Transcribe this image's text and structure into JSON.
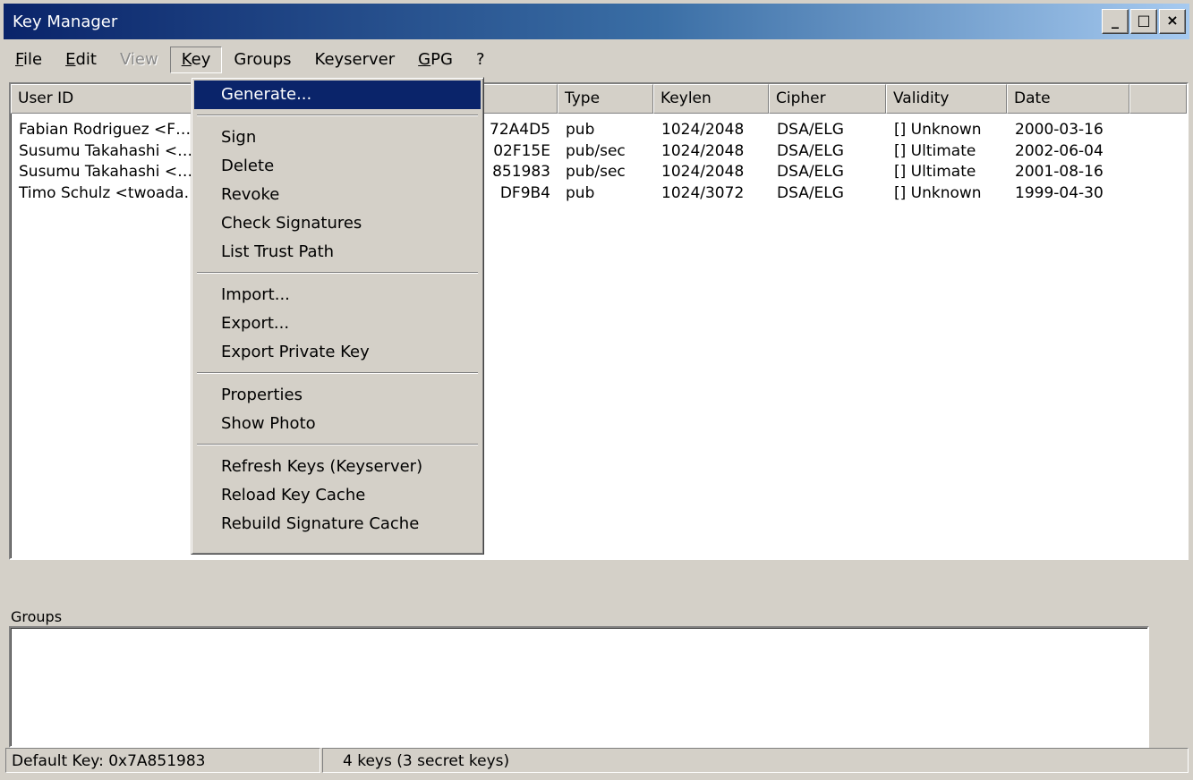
{
  "window": {
    "title": "Key Manager"
  },
  "titlebar_buttons": {
    "minimize": "_",
    "maximize": "□",
    "close": "×"
  },
  "menubar": [
    {
      "label": "File",
      "underline": "F",
      "rest": "ile",
      "state": "normal"
    },
    {
      "label": "Edit",
      "underline": "E",
      "rest": "dit",
      "state": "normal"
    },
    {
      "label": "View",
      "underline": "",
      "rest": "View",
      "state": "disabled"
    },
    {
      "label": "Key",
      "underline": "K",
      "rest": "ey",
      "state": "open"
    },
    {
      "label": "Groups",
      "underline": "",
      "rest": "Groups",
      "state": "normal"
    },
    {
      "label": "Keyserver",
      "underline": "",
      "rest": "Keyserver",
      "state": "normal"
    },
    {
      "label": "GPG",
      "underline": "G",
      "rest": "PG",
      "state": "normal"
    },
    {
      "label": "?",
      "underline": "",
      "rest": "?",
      "state": "normal"
    }
  ],
  "key_list": {
    "columns": [
      "User ID",
      "",
      "Type",
      "Keylen",
      "Cipher",
      "Validity",
      "Date"
    ],
    "rows": [
      [
        "Fabian Rodriguez <F…",
        "72A4D5",
        "pub",
        "1024/2048",
        "DSA/ELG",
        "[] Unknown",
        "2000-03-16"
      ],
      [
        "Susumu Takahashi <…",
        "02F15E",
        "pub/sec",
        "1024/2048",
        "DSA/ELG",
        "[] Ultimate",
        "2002-06-04"
      ],
      [
        "Susumu Takahashi <…",
        "851983",
        "pub/sec",
        "1024/2048",
        "DSA/ELG",
        "[] Ultimate",
        "2001-08-16"
      ],
      [
        "Timo Schulz <twoada…",
        "DF9B4",
        "pub",
        "1024/3072",
        "DSA/ELG",
        "[] Unknown",
        "1999-04-30"
      ]
    ]
  },
  "key_menu": {
    "groups": [
      [
        "Generate..."
      ],
      [
        "Sign",
        "Delete",
        "Revoke",
        "Check Signatures",
        "List Trust Path"
      ],
      [
        "Import...",
        "Export...",
        "Export Private Key"
      ],
      [
        "Properties",
        "Show Photo"
      ],
      [
        "Refresh Keys (Keyserver)",
        "Reload Key Cache",
        "Rebuild Signature Cache"
      ]
    ],
    "highlighted": "Generate..."
  },
  "groups_panel": {
    "label": "Groups"
  },
  "statusbar": {
    "default_key": "Default Key: 0x7A851983",
    "key_count": "4 keys (3 secret keys)"
  }
}
